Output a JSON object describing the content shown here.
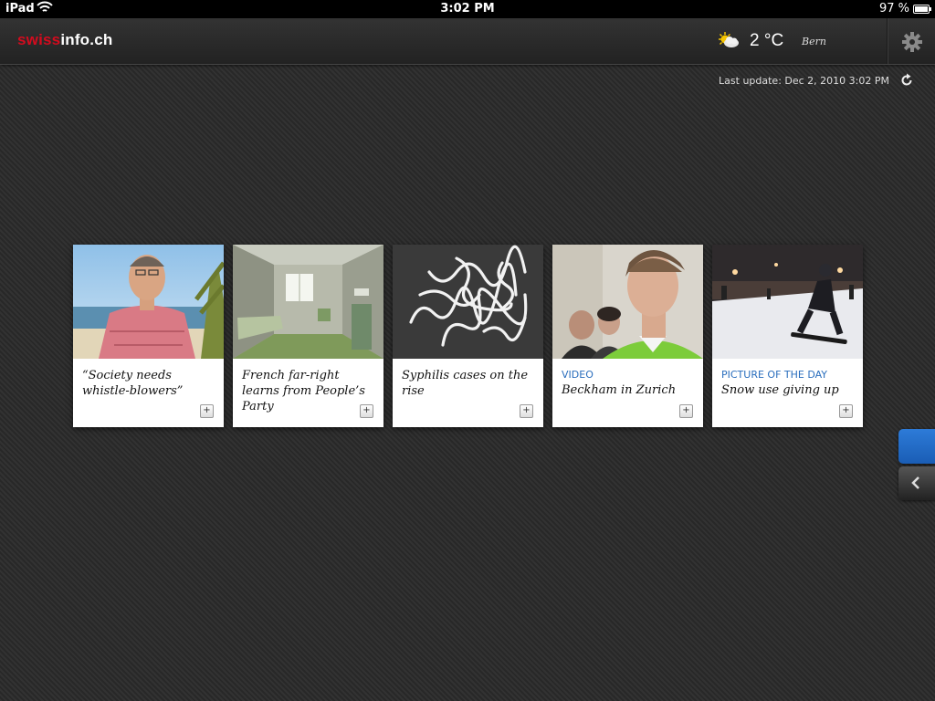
{
  "status_bar": {
    "device": "iPad",
    "time": "3:02 PM",
    "battery": "97 %",
    "battery_level": 0.97,
    "icons": [
      "wifi-icon",
      "battery-icon"
    ]
  },
  "header": {
    "logo_part1": "swiss",
    "logo_part2": "info.ch",
    "temperature": "2 °C",
    "city": "Bern",
    "weather_icon": "partly-cloudy-icon",
    "settings_icon": "gear-icon"
  },
  "update": {
    "text": "Last update: Dec 2, 2010 3:02 PM",
    "icon": "refresh-icon"
  },
  "cards": [
    {
      "tag": "",
      "title": "“Society needs whistle-blowers”"
    },
    {
      "tag": "",
      "title": "French far-right learns from People’s Party"
    },
    {
      "tag": "",
      "title": "Syphilis cases on the rise"
    },
    {
      "tag": "VIDEO",
      "title": "Beckham in Zurich"
    },
    {
      "tag": "PICTURE OF THE DAY",
      "title": "Snow use giving up"
    }
  ],
  "more_label": "+",
  "colors": {
    "logo_red": "#d40b1e",
    "tag_blue": "#2a6ebd",
    "side_blue": "#1f6bc7"
  },
  "side_controls": [
    "blue-tab",
    "chevron-left-icon"
  ]
}
